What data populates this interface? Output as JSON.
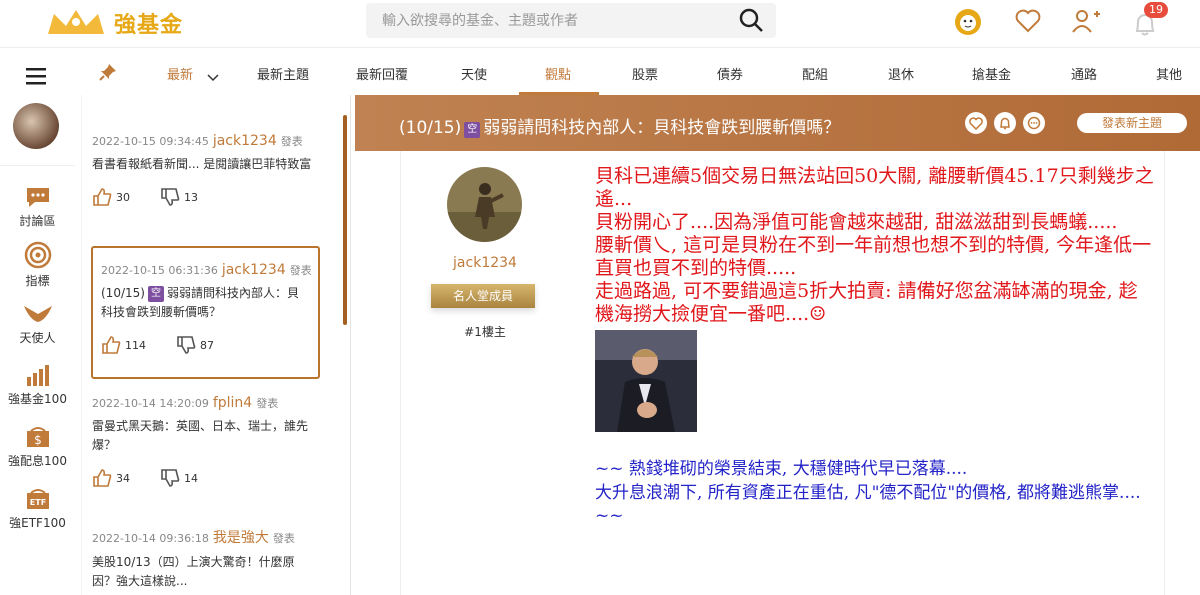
{
  "header": {
    "logo_text": "強基金",
    "search_placeholder": "輸入欲搜尋的基金、主題或作者",
    "notification_count": "19"
  },
  "nav": {
    "tabs": [
      "最新",
      "最新主題",
      "最新回覆",
      "天使",
      "觀點",
      "股票",
      "債券",
      "配組",
      "退休",
      "搶基金",
      "通路",
      "其他"
    ],
    "active_tab": "觀點"
  },
  "sidebar": {
    "items": [
      "討論區",
      "指標",
      "天使人",
      "強基金100",
      "強配息100",
      "強ETF100"
    ]
  },
  "post_list": [
    {
      "time": "2022-10-15 09:34:45",
      "author": "jack1234",
      "action": "發表",
      "excerpt": "看書看報紙看新聞... 是閱讀讓巴菲特致富",
      "likes": "30",
      "dislikes": "13"
    },
    {
      "time": "2022-10-15 06:31:36",
      "author": "jack1234",
      "action": "發表",
      "excerpt_prefix": "(10/15)",
      "badge": "空",
      "excerpt": "弱弱請問科技內部人：貝科技會跌到腰斬價嗎？",
      "likes": "114",
      "dislikes": "87"
    },
    {
      "time": "2022-10-14 14:20:09",
      "author": "fplin4",
      "action": "發表",
      "excerpt": "雷曼式黑天鵝：英國、日本、瑞士，誰先爆？",
      "likes": "34",
      "dislikes": "14"
    },
    {
      "time": "2022-10-14 09:36:18",
      "author": "我是強大",
      "action": "發表",
      "excerpt": "美股10/13（四）上演大驚奇！什麼原因？強大這樣說..."
    }
  ],
  "topic": {
    "title_prefix": "(10/15)",
    "badge": "空",
    "title": "弱弱請問科技內部人：貝科技會跌到腰斬價嗎？",
    "new_topic_label": "發表新主題"
  },
  "post": {
    "username": "jack1234",
    "rank": "名人堂成員",
    "floor": "#1樓主",
    "red_lines": [
      "貝科已連續5個交易日無法站回50大關, 離腰斬價45.17只剩幾步之遙...",
      "貝粉開心了....因為淨值可能會越來越甜, 甜滋滋甜到長螞蟻.....",
      "腰斬價乀, 這可是貝粉在不到一年前想也想不到的特價, 今年逢低一直買也買不到的特價.....",
      "走過路過, 可不要錯過這5折大拍賣: 請備好您盆滿缽滿的現金, 趁機海撈大撿便宜一番吧....☺"
    ],
    "blue_lines": [
      "~~ 熱錢堆砌的榮景結束, 大穩健時代早已落幕....",
      "大升息浪潮下, 所有資產正在重估, 凡\"德不配位\"的價格, 都將難逃熊掌.... ~~"
    ]
  }
}
